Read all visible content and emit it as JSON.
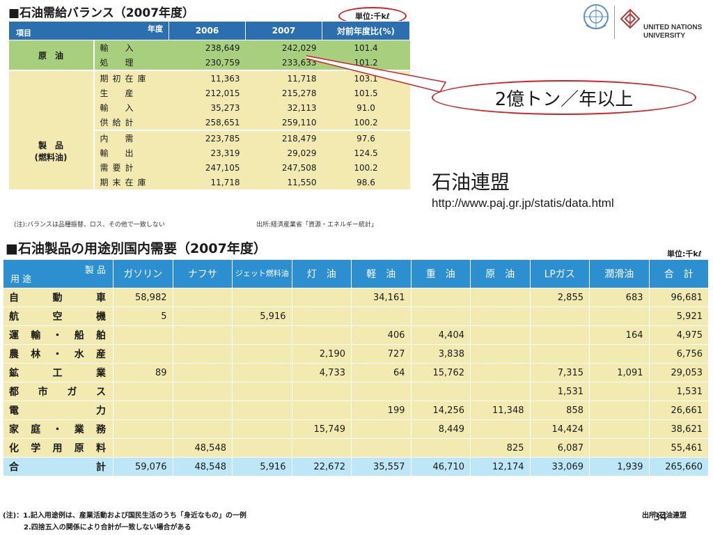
{
  "slide": {
    "title1": "■石油需給バランス（2007年度）",
    "unit1": "単位:千kℓ",
    "table1": {
      "header_item": "項目",
      "header_year": "年度",
      "columns": [
        "2006",
        "2007",
        "対前年度比(%)"
      ],
      "crude": {
        "group": "原　油",
        "rows": [
          {
            "label": "輸　入",
            "v2006": "238,649",
            "v2007": "242,029",
            "ratio": "101.4"
          },
          {
            "label": "処　理",
            "v2006": "230,759",
            "v2007": "233,633",
            "ratio": "101.2"
          }
        ]
      },
      "products": {
        "group_line1": "製　品",
        "group_line2": "(燃料油)",
        "rows": [
          {
            "label": "期初在庫",
            "v2006": "11,363",
            "v2007": "11,718",
            "ratio": "103.1"
          },
          {
            "label": "生　産",
            "v2006": "212,015",
            "v2007": "215,278",
            "ratio": "101.5"
          },
          {
            "label": "輸　入",
            "v2006": "35,273",
            "v2007": "32,113",
            "ratio": "91.0"
          },
          {
            "label": "供給計",
            "v2006": "258,651",
            "v2007": "259,110",
            "ratio": "100.2"
          },
          {
            "label": "内　需",
            "v2006": "223,785",
            "v2007": "218,479",
            "ratio": "97.6"
          },
          {
            "label": "輸　出",
            "v2006": "23,319",
            "v2007": "29,029",
            "ratio": "124.5"
          },
          {
            "label": "需要計",
            "v2006": "247,105",
            "v2007": "247,508",
            "ratio": "100.2"
          },
          {
            "label": "期末在庫",
            "v2006": "11,718",
            "v2007": "11,550",
            "ratio": "98.6"
          }
        ]
      },
      "note": "(注):バランスは品種振替、ロス、その他で一致しない",
      "source": "出所:経済産業省「資源・エネルギー統計」"
    },
    "callout": "2億トン／年以上",
    "paj_name": "石油連盟",
    "paj_url": "http://www.paj.gr.jp/statis/data.html",
    "logo": {
      "line1": "UNITED NATIONS",
      "line2": "UNIVERSITY"
    },
    "title2": "■石油製品の用途別国内需要（2007年度）",
    "unit2": "単位:千kℓ",
    "table2": {
      "header_product": "製 品",
      "header_use": "用 途",
      "columns": [
        "ガソリン",
        "ナフサ",
        "ジェット燃料油",
        "灯　油",
        "軽　油",
        "重　油",
        "原　油",
        "LPガス",
        "潤滑油",
        "合　計"
      ],
      "rows": [
        {
          "use": "自動車",
          "cells": [
            "58,982",
            "",
            "",
            "",
            "34,161",
            "",
            "",
            "2,855",
            "683",
            "96,681"
          ]
        },
        {
          "use": "航空機",
          "cells": [
            "5",
            "",
            "5,916",
            "",
            "",
            "",
            "",
            "",
            "",
            "5,921"
          ]
        },
        {
          "use": "運輸・船舶",
          "cells": [
            "",
            "",
            "",
            "",
            "406",
            "4,404",
            "",
            "",
            "164",
            "4,975"
          ]
        },
        {
          "use": "農林・水産",
          "cells": [
            "",
            "",
            "",
            "2,190",
            "727",
            "3,838",
            "",
            "",
            "",
            "6,756"
          ]
        },
        {
          "use": "鉱工業",
          "cells": [
            "89",
            "",
            "",
            "4,733",
            "64",
            "15,762",
            "",
            "7,315",
            "1,091",
            "29,053"
          ]
        },
        {
          "use": "都市ガス",
          "cells": [
            "",
            "",
            "",
            "",
            "",
            "",
            "",
            "1,531",
            "",
            "1,531"
          ]
        },
        {
          "use": "電力",
          "cells": [
            "",
            "",
            "",
            "",
            "199",
            "14,256",
            "11,348",
            "858",
            "",
            "26,661"
          ]
        },
        {
          "use": "家庭・業務",
          "cells": [
            "",
            "",
            "",
            "15,749",
            "",
            "8,449",
            "",
            "14,424",
            "",
            "38,621"
          ]
        },
        {
          "use": "化学用原料",
          "cells": [
            "",
            "48,548",
            "",
            "",
            "",
            "",
            "825",
            "6,087",
            "",
            "55,461"
          ]
        }
      ],
      "total": {
        "use": "合計",
        "cells": [
          "59,076",
          "48,548",
          "5,916",
          "22,672",
          "35,557",
          "46,710",
          "12,174",
          "33,069",
          "1,939",
          "265,660"
        ]
      },
      "note1": "(注)：1.記入用途例は、産業活動および国民生活のうち「身近なもの」の一例",
      "note2": "2.四捨五入の関係により合計が一致しない場合がある",
      "source": "出所:石油連盟"
    },
    "page_number": "34"
  }
}
